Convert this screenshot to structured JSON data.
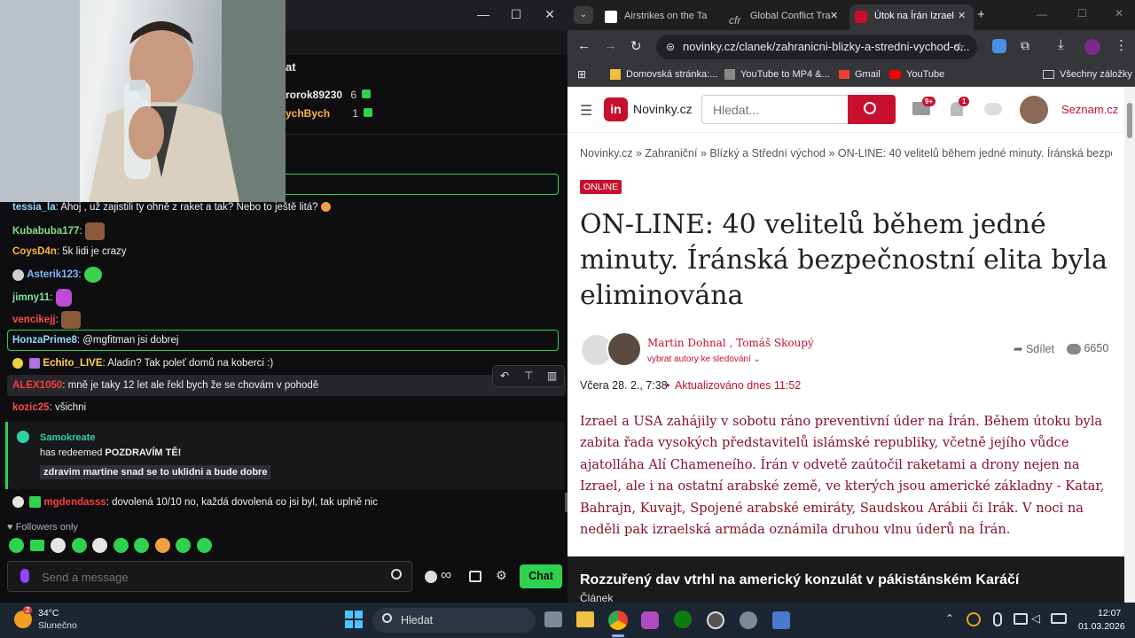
{
  "chat": {
    "header_title": "at",
    "top_gifters": [
      {
        "name": "rorok89230",
        "count": "6"
      },
      {
        "name": "zychBych",
        "count": "1"
      }
    ],
    "messages": [
      {
        "user": "tessia_la",
        "text": ": Ahoj , už zajistili ty ohně z raket a tak? Nebo to ještě litá?",
        "color": "#8fd9ff"
      },
      {
        "user": "Kubabuba177",
        "text": ":",
        "color": "#7fe17f"
      },
      {
        "user": "CoysD4n",
        "text": ": 5k lidi je crazy",
        "color": "#ffb347"
      },
      {
        "user": "Asterik123",
        "text": ":",
        "color": "#7fb7ff"
      },
      {
        "user": "jimny11",
        "text": ":",
        "color": "#7fe1a9"
      },
      {
        "user": "vencikejj",
        "text": ":",
        "color": "#ff4d4d"
      },
      {
        "user": "HonzaPrime8",
        "text": ": @mgfitman jsi dobrej",
        "color": "#8fd9ff"
      },
      {
        "user": "Echito_LIVE",
        "text": ": Aladin? Tak poleť domů na koberci :)",
        "color": "#ffd24d"
      },
      {
        "user": "ALEX1050",
        "text": ": mně je taky 12 let ale řekl bych že se chovám v pohodě",
        "color": "#ff3b3b"
      },
      {
        "user": "kozic25",
        "text": ": všichni",
        "color": "#ff4d4d"
      }
    ],
    "redeem": {
      "user": "Samokreate",
      "text_prefix": "has redeemed ",
      "reward": "POZDRAVÍM TĚ!",
      "message": "zdravim martine snad se to uklidni a bude dobre"
    },
    "last_message": {
      "user": "mgdendasss",
      "text": ": dovolená 10/10 no, každá dovolená co jsi byl, tak uplně nic",
      "color": "#ff3b3b"
    },
    "followers_only": "Followers only",
    "input_placeholder": "Send a message",
    "chat_button": "Chat",
    "infinity_label": "∞"
  },
  "browser": {
    "tabs": [
      {
        "label": "Airstrikes on the Ta"
      },
      {
        "label": "Global Conflict Tra"
      },
      {
        "label": "Útok na Írán Izrael"
      }
    ],
    "url": "novinky.cz/clanek/zahranicni-blizky-a-stredni-vychod-o...",
    "bookmarks": [
      {
        "label": "Domovská stránka:..."
      },
      {
        "label": "YouTube to MP4 &..."
      },
      {
        "label": "Gmail"
      },
      {
        "label": "YouTube"
      },
      {
        "label": "Všechny záložky"
      }
    ],
    "site": {
      "logo_text": "Novinky.cz",
      "logo_mark": "in",
      "search_placeholder": "Hledat...",
      "mail_badge": "9+",
      "bell_badge": "1",
      "seznam_link": "Seznam.cz"
    },
    "article": {
      "breadcrumb": "Novinky.cz » Zahraniční » Blízký a Střední východ » ON-LINE: 40 velitelů během jedné minuty. Íránská bezpečno...",
      "badge": "ONLINE",
      "title": "ON-LINE: 40 velitelů během jedné minuty. Íránská bezpečnostní elita byla eliminována",
      "authors": "Martin Dohnal , Tomáš Skoupý",
      "follow_link": "vybrat autory ke sledování",
      "share": "Sdílet",
      "comments": "6650",
      "date": "Včera 28. 2., 7:38",
      "updated": "Aktualizováno dnes 11:52",
      "lead": "Izrael a USA zahájily v sobotu ráno preventivní úder na Írán. Během útoku byla zabita řada vysokých představitelů islámské republiky, včetně jejího vůdce ajatolláha Alí Chameneího. Írán v odvetě zaútočil raketami a drony nejen na Izrael, ale i na ostatní arabské země, ve kterých jsou americké základny - Katar, Bahrajn, Kuvajt, Spojené arabské emiráty, Saudskou Arábii či Irák. V noci na neděli pak izraelská armáda oznámila druhou vlnu úderů na Írán."
    },
    "related": {
      "title": "Rozzuřený dav vtrhl na americký konzulát v pákistánském Karáčí",
      "type": "Článek"
    }
  },
  "taskbar": {
    "weather_temp": "34°C",
    "weather_desc": "Slunečno",
    "weather_badge": "2",
    "search_placeholder": "Hledat",
    "time": "12:07",
    "date": "01.03.2026"
  }
}
